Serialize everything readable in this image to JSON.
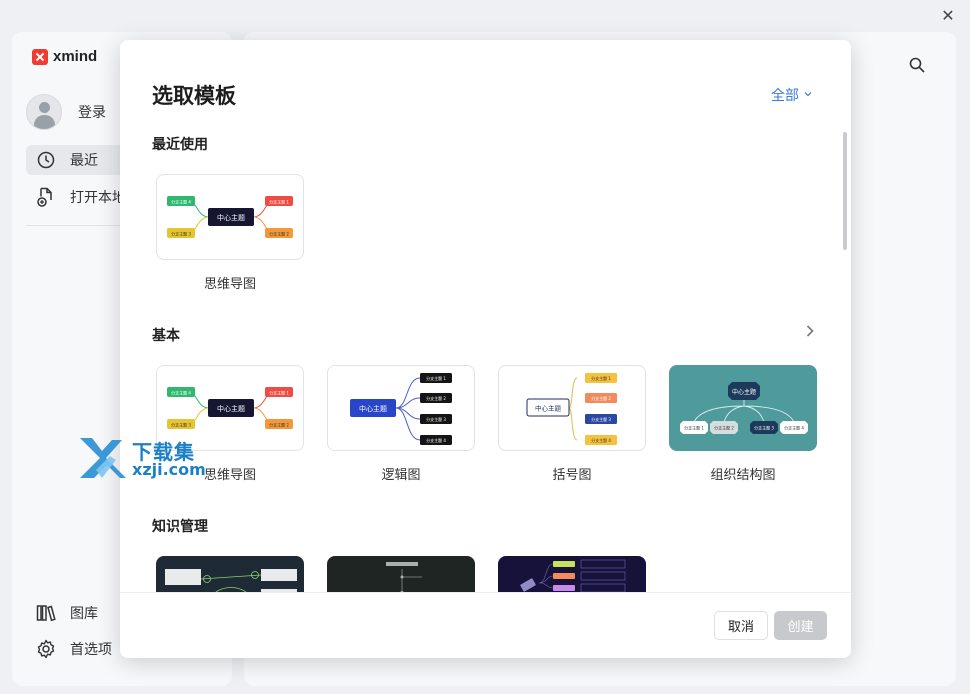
{
  "app": {
    "logo_text": "xmind"
  },
  "sidebar": {
    "login_label": "登录",
    "items": [
      {
        "label": "最近",
        "icon": "clock-icon",
        "active": true
      },
      {
        "label": "打开本地",
        "icon": "file-plus-icon"
      },
      {
        "label": "图库",
        "icon": "library-icon"
      },
      {
        "label": "首选项",
        "icon": "gear-icon"
      }
    ]
  },
  "watermark": {
    "line1": "下载集",
    "line2": "xzji.com"
  },
  "dialog": {
    "title": "选取模板",
    "filter_label": "全部",
    "sections": {
      "recent": {
        "title": "最近使用",
        "cards": [
          {
            "label": "思维导图"
          }
        ]
      },
      "basic": {
        "title": "基本",
        "cards": [
          {
            "label": "思维导图"
          },
          {
            "label": "逻辑图"
          },
          {
            "label": "括号图"
          },
          {
            "label": "组织结构图"
          }
        ]
      },
      "knowledge": {
        "title": "知识管理"
      }
    },
    "thumb_text": {
      "center": "中心主题",
      "b1": "分支主题 1",
      "b2": "分支主题 2",
      "b3": "分支主题 3",
      "b4": "分支主题 4"
    },
    "footer": {
      "cancel_label": "取消",
      "create_label": "创建"
    }
  },
  "colors": {
    "accent": "#3a7bd5",
    "org_bg": "#4f9a9b",
    "dark_thumb": "#1e2a35"
  }
}
